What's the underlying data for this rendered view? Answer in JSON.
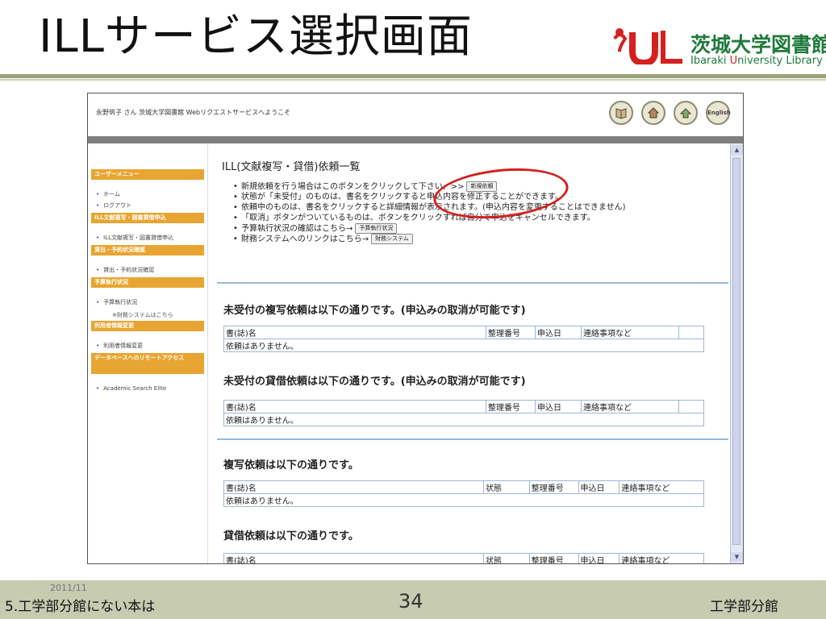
{
  "slide": {
    "title": "ILLサービス選択画面",
    "logo": {
      "jp": "茨城大学図書館",
      "en_pre": "Ibaraki ",
      "en_mid": "U",
      "en_post": "niversity Library"
    },
    "footer": {
      "date": "2011/11",
      "left": "5.工学部分館にない本は",
      "page": "34",
      "right": "工学部分館"
    }
  },
  "screen": {
    "welcome": "永野筑子 さん 茨城大学図書館 Webリクエストサービスへようこそ",
    "topicons": [
      "book-icon",
      "home-icon",
      "search-icon",
      "English"
    ],
    "sidebar": {
      "head_user": "ユーザーメニュー",
      "home": "ホーム",
      "logout": "ログアウト",
      "head_ill": "ILL文献複写・図書貸借申込",
      "ill_apply": "ILL文献複写・図書貸借申込",
      "head_status": "貸出・予約状況確認",
      "status": "貸出・予約状況確認",
      "head_budget": "予算執行状況",
      "budget": "予算執行状況",
      "budget_note": "※財務システムはこちら",
      "head_userinfo": "利用者情報変更",
      "userinfo": "利用者情報変更",
      "head_remote": "データベースへのリモートアクセス",
      "remote": "Academic Search Elite"
    },
    "content": {
      "title": "ILL(文献複写・貸借)依頼一覧",
      "bullet1": "新規依頼を行う場合はこのボタンをクリックして下さい。>>",
      "btn_new": "新規依頼",
      "bullet2": "状態が「未受付」のものは、書名をクリックすると申込内容を修正することができます。",
      "bullet3": "依頼中のものは、書名をクリックすると詳細情報が表示されます。(申込内容を変更することはできません)",
      "bullet4": "「取消」ボタンがついているものは、ボタンをクリックすれば自分で申込をキャンセルできます。",
      "bullet5": "予算執行状況の確認はこちら→",
      "btn_budget": "予算執行状況",
      "bullet6": "財務システムへのリンクはこちら→",
      "btn_finance": "財務システム",
      "sec1": "未受付の複写依頼は以下の通りです。(申込みの取消が可能です)",
      "sec2": "未受付の貸借依頼は以下の通りです。(申込みの取消が可能です)",
      "sec3": "複写依頼は以下の通りです。",
      "sec4": "貸借依頼は以下の通りです。",
      "col_title": "書(誌)名",
      "col_number": "整理番号",
      "col_date": "申込日",
      "col_notes": "連絡事項など",
      "col_status": "状態",
      "empty": "依頼はありません。"
    }
  }
}
